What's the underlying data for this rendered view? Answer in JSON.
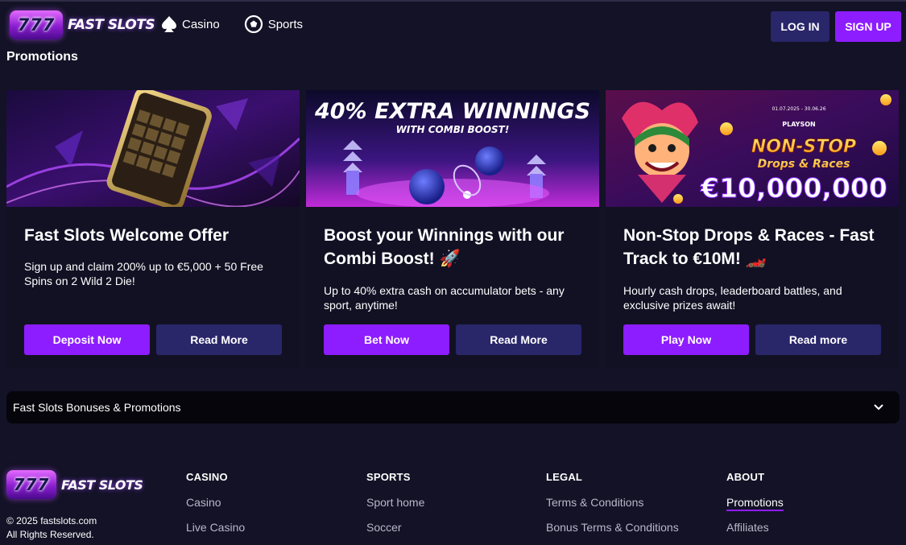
{
  "header": {
    "logo_number": "777",
    "logo_text": "FAST SLOTS",
    "nav": [
      {
        "label": "Casino",
        "icon": "spade-icon"
      },
      {
        "label": "Sports",
        "icon": "soccer-ball-icon"
      }
    ],
    "login_label": "LOG IN",
    "signup_label": "SIGN UP"
  },
  "page_title": "Promotions",
  "cards": [
    {
      "image_icon": "phone-slot-banner",
      "title": "Fast Slots Welcome Offer",
      "description": "Sign up and claim 200% up to €5,000 + 50 Free Spins on 2 Wild 2 Die!",
      "primary_label": "Deposit Now",
      "secondary_label": "Read More"
    },
    {
      "image_icon": "combi-boost-banner",
      "image_headline": "40% EXTRA WINNINGS",
      "image_subline": "WITH COMBI BOOST!",
      "title": "Boost your Winnings with our Combi Boost! 🚀",
      "description": "Up to 40% extra cash on accumulator bets - any sport, anytime!",
      "primary_label": "Bet Now",
      "secondary_label": "Read More"
    },
    {
      "image_icon": "jester-banner",
      "image_dates": "01.07.2025 - 30.06.26",
      "image_brand": "PLAYSON",
      "image_headline": "NON-STOP",
      "image_subline": "Drops & Races",
      "image_amount": "€10,000,000",
      "title": "Non-Stop Drops & Races - Fast Track to €10M! 🏎️",
      "description": "Hourly cash drops, leaderboard battles, and exclusive prizes await!",
      "primary_label": "Play Now",
      "secondary_label": "Read more"
    }
  ],
  "accordion": {
    "label": "Fast Slots Bonuses & Promotions",
    "icon": "chevron-down-icon"
  },
  "footer": {
    "logo_number": "777",
    "logo_text": "FAST SLOTS",
    "copyright_line1": "© 2025 fastslots.com",
    "copyright_line2": "All Rights Reserved.",
    "columns": [
      {
        "heading": "CASINO",
        "links": [
          "Casino",
          "Live Casino"
        ]
      },
      {
        "heading": "SPORTS",
        "links": [
          "Sport home",
          "Soccer"
        ]
      },
      {
        "heading": "LEGAL",
        "links": [
          "Terms & Conditions",
          "Bonus Terms & Conditions"
        ]
      },
      {
        "heading": "ABOUT",
        "links": [
          "Promotions",
          "Affiliates"
        ]
      }
    ]
  },
  "colors": {
    "background": "#131226",
    "primary": "#8d1dff",
    "secondary": "#29266a",
    "accordion": "#05050b"
  }
}
